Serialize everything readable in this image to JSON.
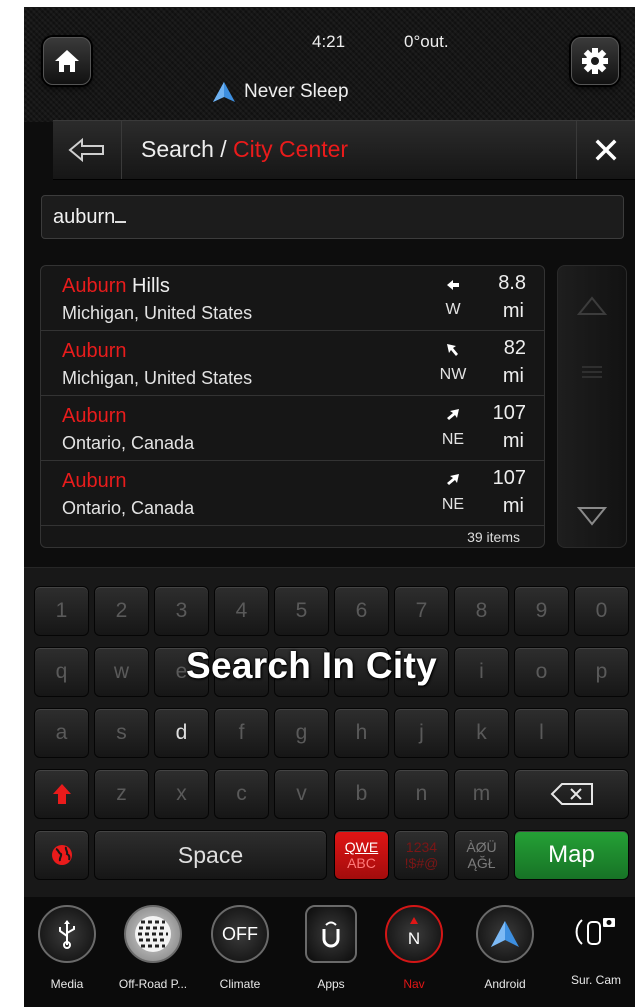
{
  "status": {
    "time": "4:21",
    "temp": "0°out.",
    "app_label": "Never Sleep"
  },
  "header": {
    "title_prefix": "Search / ",
    "title_highlight": "City Center"
  },
  "search": {
    "value": "auburn"
  },
  "results": {
    "items": [
      {
        "name_match": "Auburn",
        "name_rest": " Hills",
        "region": "Michigan, United States",
        "direction": "W",
        "distance": "8.8",
        "unit": "mi"
      },
      {
        "name_match": "Auburn",
        "name_rest": "",
        "region": "Michigan, United States",
        "direction": "NW",
        "distance": "82",
        "unit": "mi"
      },
      {
        "name_match": "Auburn",
        "name_rest": "",
        "region": "Ontario, Canada",
        "direction": "NE",
        "distance": "107",
        "unit": "mi"
      },
      {
        "name_match": "Auburn",
        "name_rest": "",
        "region": "Ontario, Canada",
        "direction": "NE",
        "distance": "107",
        "unit": "mi"
      }
    ],
    "count": "39 items"
  },
  "keyboard": {
    "row_numbers": [
      "1",
      "2",
      "3",
      "4",
      "5",
      "6",
      "7",
      "8",
      "9",
      "0"
    ],
    "row_top": [
      "q",
      "w",
      "e",
      "",
      "",
      "",
      "",
      "i",
      "o",
      "p"
    ],
    "row_middle": [
      "a",
      "s",
      "d",
      "f",
      "g",
      "h",
      "j",
      "k",
      "l",
      ""
    ],
    "row_bottom": [
      "z",
      "x",
      "c",
      "v",
      "b",
      "n",
      "m"
    ],
    "space_label": "Space",
    "qwe_top": "QWE",
    "qwe_bottom": "ABC",
    "num_top": "1234",
    "num_bottom": "!$#@",
    "acc_top": "ÀØÜ",
    "acc_bottom": "ĄĞŁ",
    "map_label": "Map",
    "overlay_text": "Search In City"
  },
  "dock": [
    {
      "label": "Media",
      "icon": "usb-icon"
    },
    {
      "label": "Off-Road P...",
      "icon": "tire-icon"
    },
    {
      "label": "Climate",
      "icon": "climate-off-icon"
    },
    {
      "label": "Apps",
      "icon": "uconnect-icon"
    },
    {
      "label": "Nav",
      "icon": "compass-icon"
    },
    {
      "label": "Android",
      "icon": "android-auto-icon"
    },
    {
      "label": "Sur. Cam",
      "icon": "surround-camera-icon"
    }
  ],
  "colors": {
    "accent_red": "#e81c1c",
    "map_green": "#1f8a2e",
    "background": "#0d0d0d"
  }
}
